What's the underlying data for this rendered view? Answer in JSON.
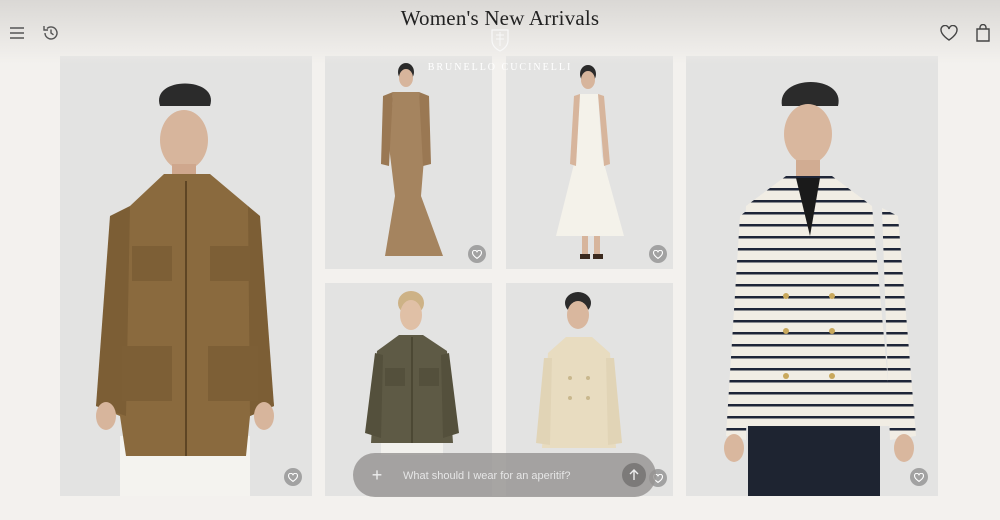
{
  "header": {
    "title": "Women's New Arrivals",
    "brand": "BRUNELLO CUCINELLI",
    "icons": [
      "menu-icon",
      "history-icon",
      "heart-icon",
      "shopping-bag-icon"
    ]
  },
  "products": [
    {
      "name": "suede field jacket",
      "icon": "heart-icon"
    },
    {
      "name": "satin maxi dress",
      "icon": "heart-icon"
    },
    {
      "name": "white halter dress",
      "icon": "heart-icon"
    },
    {
      "name": "olive shirt jacket",
      "icon": "heart-icon"
    },
    {
      "name": "cream knit jacket",
      "icon": "heart-icon"
    },
    {
      "name": "striped double-breasted blazer",
      "icon": "heart-icon"
    }
  ],
  "chat": {
    "placeholder": "What should I wear for an aperitif?",
    "plus_label": "+"
  },
  "colors": {
    "background": "#f3f1ee",
    "tile": "#e2e2e1",
    "chat_bar": "#969492"
  }
}
